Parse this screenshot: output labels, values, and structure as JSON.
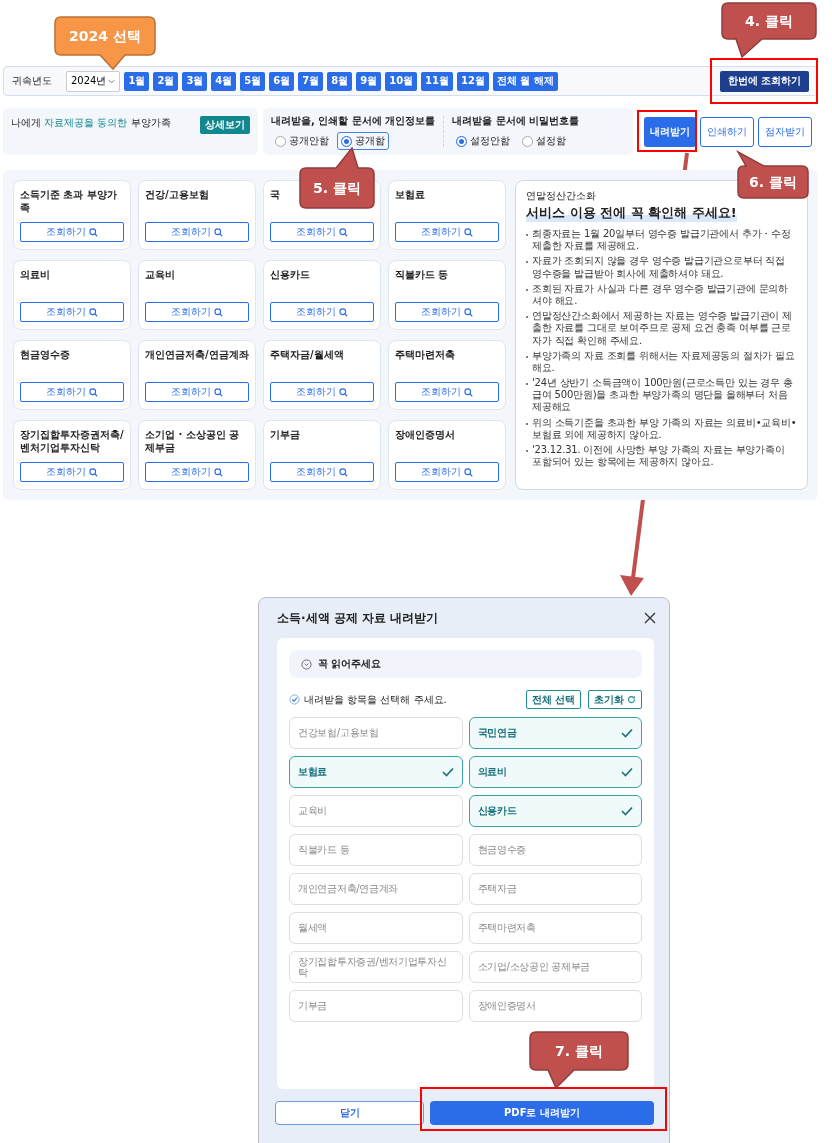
{
  "year_bar": {
    "label": "귀속년도",
    "year": "2024년",
    "months": [
      "1월",
      "2월",
      "3월",
      "4월",
      "5월",
      "6월",
      "7월",
      "8월",
      "9월",
      "10월",
      "11월",
      "12월"
    ],
    "clear_button": "전체 월 해제",
    "query_all_button": "한번에 조회하기"
  },
  "dependents": {
    "before": "나에게 ",
    "highlight": "자료제공을 동의한",
    "after": " 부양가족",
    "detail_button": "상세보기"
  },
  "privacy": {
    "label": "내려받을, 인쇄할 문서에 개인정보를",
    "options": [
      {
        "label": "공개안함",
        "selected": false
      },
      {
        "label": "공개함",
        "selected": true
      }
    ]
  },
  "password": {
    "label": "내려받을 문서에 비밀번호를",
    "options": [
      {
        "label": "설정안함",
        "selected": true
      },
      {
        "label": "설정함",
        "selected": false
      }
    ]
  },
  "actions": [
    {
      "label": "내려받기",
      "kind": "primary"
    },
    {
      "label": "인쇄하기",
      "kind": "outline"
    },
    {
      "label": "점자받기",
      "kind": "outline"
    }
  ],
  "categories": [
    {
      "title": "소득기준 초과 부양가족",
      "button": "조회하기"
    },
    {
      "title": "건강/고용보험",
      "button": "조회하기"
    },
    {
      "title": "국",
      "button": "조회하기"
    },
    {
      "title": "보험료",
      "button": "조회하기"
    },
    {
      "title": "의료비",
      "button": "조회하기"
    },
    {
      "title": "교육비",
      "button": "조회하기"
    },
    {
      "title": "신용카드",
      "button": "조회하기"
    },
    {
      "title": "직불카드 등",
      "button": "조회하기"
    },
    {
      "title": "현금영수증",
      "button": "조회하기"
    },
    {
      "title": "개인연금저축/연금계좌",
      "button": "조회하기"
    },
    {
      "title": "주택자금/월세액",
      "button": "조회하기"
    },
    {
      "title": "주택마련저축",
      "button": "조회하기"
    },
    {
      "title": "장기집합투자증권저축/벤처기업투자신탁",
      "button": "조회하기"
    },
    {
      "title": "소기업 · 소상공인 공제부금",
      "button": "조회하기"
    },
    {
      "title": "기부금",
      "button": "조회하기"
    },
    {
      "title": "장애인증명서",
      "button": "조회하기"
    }
  ],
  "notice": {
    "subtitle": "연말정산간소화",
    "title": "서비스 이용 전에 꼭 확인해 주세요!",
    "items": [
      "최종자료는 1월 20일부터 영수증 발급기관에서 추가・수정 제출한 자료를 제공해요.",
      "자료가 조회되지 않을 경우 영수증 발급기관으로부터 직접 영수증을 발급받아 회사에 제출하셔야 돼요.",
      "조회된 자료가 사실과 다른 경우 영수증 발급기관에 문의하셔야 해요.",
      "연말정산간소화에서 제공하는 자료는 영수증 발급기관이 제출한 자료를 그대로 보여주므로 공제 요건 충족 여부를 근로자가 직접 확인해 주세요.",
      "부양가족의 자료 조회를 위해서는 자료제공동의 절차가 필요해요.",
      "'24년 상반기 소득금액이 100만원(근로소득만 있는 경우 총급여 500만원)을 초과한 부양가족의 명단을 올해부터 처음 제공해요",
      "위의 소득기준을 초과한 부양 가족의 자료는 의료비•교육비•보험료 외에 제공하지 않아요.",
      "'23.12.31. 이전에 사망한 부양 가족의 자료는 부양가족이 포함되어 있는 항목에는 제공하지 않아요."
    ]
  },
  "modal": {
    "title": "소득·세액 공제 자료 내려받기",
    "accordion": "꼭 읽어주세요",
    "instruction": "내려받을 항목을 선택해 주세요.",
    "select_all": "전체 선택",
    "reset": "초기화",
    "items": [
      {
        "label": "건강보험/고용보험",
        "selected": false
      },
      {
        "label": "국민연금",
        "selected": true
      },
      {
        "label": "보험료",
        "selected": true
      },
      {
        "label": "의료비",
        "selected": true
      },
      {
        "label": "교육비",
        "selected": false
      },
      {
        "label": "신용카드",
        "selected": true
      },
      {
        "label": "직불카드 등",
        "selected": false
      },
      {
        "label": "현금영수증",
        "selected": false
      },
      {
        "label": "개인연금저축/연금계좌",
        "selected": false
      },
      {
        "label": "주택자금",
        "selected": false
      },
      {
        "label": "월세액",
        "selected": false
      },
      {
        "label": "주택마련저축",
        "selected": false
      },
      {
        "label": "장기집합투자증권/벤처기업투자신탁",
        "selected": false
      },
      {
        "label": "소기업/소상공인 공제부금",
        "selected": false
      },
      {
        "label": "기부금",
        "selected": false
      },
      {
        "label": "장애인증명서",
        "selected": false
      }
    ],
    "buttons": [
      {
        "label": "닫기",
        "kind": "outline"
      },
      {
        "label": "PDF로 내려받기",
        "kind": "primary"
      }
    ]
  },
  "annotations": [
    {
      "text": "2024 선택",
      "color": "#f79646"
    },
    {
      "text": "4. 클릭",
      "color": "#c0504d"
    },
    {
      "text": "5. 클릭",
      "color": "#c0504d"
    },
    {
      "text": "6. 클릭",
      "color": "#c0504d"
    },
    {
      "text": "7. 클릭",
      "color": "#c0504d"
    }
  ]
}
